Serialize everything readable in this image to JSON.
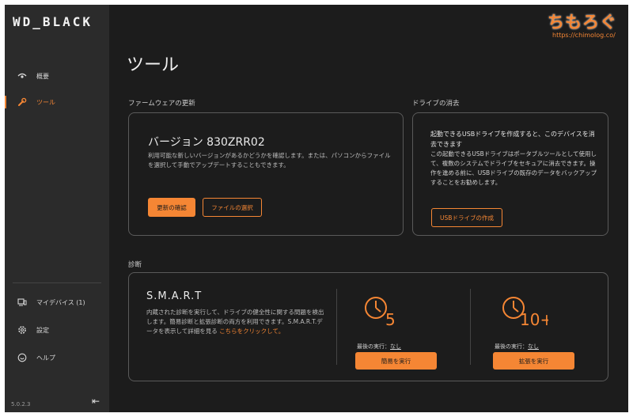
{
  "app": {
    "logo": "WD_BLACK",
    "version": "5.0.2.3"
  },
  "sidebar": {
    "items": [
      {
        "label": "概要",
        "icon": "eye-icon"
      },
      {
        "label": "ツール",
        "icon": "wrench-icon",
        "active": true
      }
    ],
    "bottom_items": [
      {
        "label": "マイデバイス (1)",
        "icon": "devices-icon"
      },
      {
        "label": "設定",
        "icon": "gear-icon"
      },
      {
        "label": "ヘルプ",
        "icon": "help-icon"
      }
    ]
  },
  "page": {
    "title": "ツール"
  },
  "firmware": {
    "section_label": "ファームウェアの更新",
    "title": "バージョン 830ZRR02",
    "description": "利用可能な新しいバージョンがあるかどうかを確認します。または、パソコンからファイルを選択して手動でアップデートすることもできます。",
    "check_button": "更新の確認",
    "select_file_button": "ファイルの選択"
  },
  "drive_erase": {
    "section_label": "ドライブの消去",
    "description_main": "起動できるUSBドライブを作成すると、このデバイスを消去できます",
    "description_detail": "この起動できるUSBドライブはポータブルツールとして使用して、複数のシステムでドライブをセキュアに消去できます。操作を進める前に、USBドライブの既存のデータをバックアップすることをお勧めします。",
    "create_button": "USBドライブの作成"
  },
  "diagnostics": {
    "section_label": "診断",
    "smart_title": "S.M.A.R.T",
    "description": "内蔵された診断を実行して、ドライブの健全性に関する問題を検出します。簡易診断と拡張診断の両方を利用できます。S.M.A.R.T.データを表示して詳細を見る",
    "link_text": "こちらをクリックして。",
    "quick_test": {
      "minutes": "5",
      "last_run_label": "最後の実行：",
      "last_run_value": "なし",
      "button": "簡易を実行"
    },
    "extended_test": {
      "minutes": "10+",
      "last_run_label": "最後の実行：",
      "last_run_value": "なし",
      "button": "拡張を実行"
    }
  },
  "watermark": {
    "title": "ちもろぐ",
    "url": "https://chimolog.co/"
  },
  "colors": {
    "accent": "#f58634",
    "background": "#1c1c1c",
    "sidebar": "#2b2b2b",
    "border": "#5a5a5a"
  }
}
